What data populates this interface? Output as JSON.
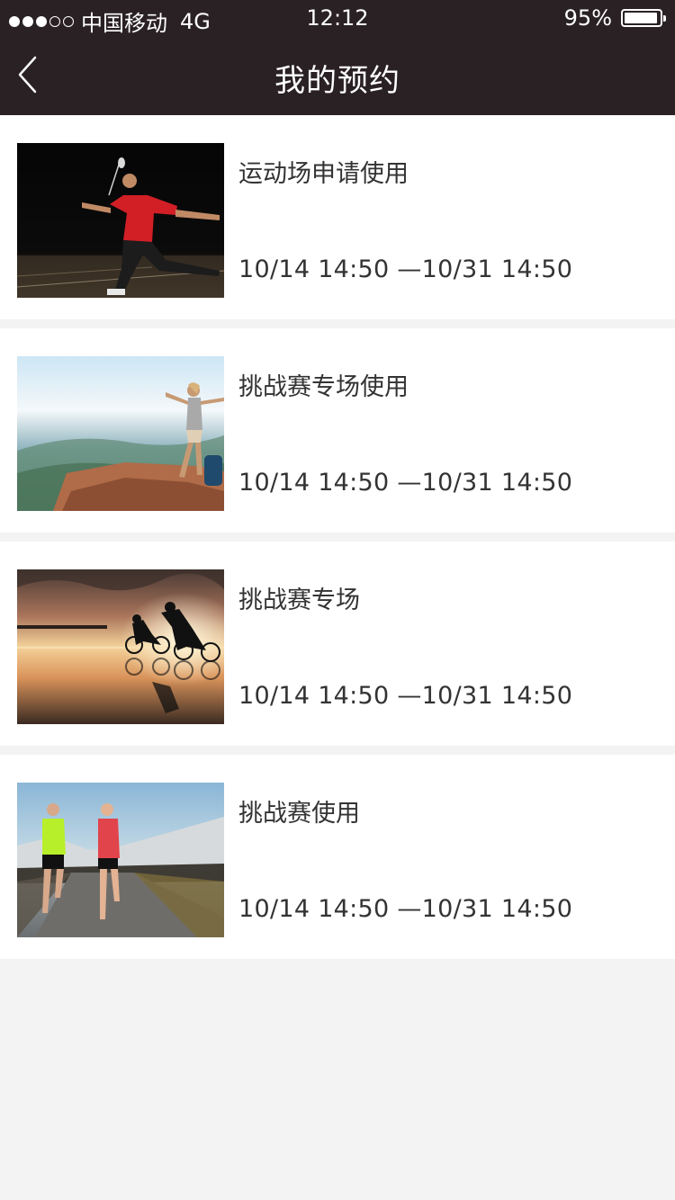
{
  "status_bar": {
    "carrier": "中国移动",
    "network": "4G",
    "time": "12:12",
    "battery": "95%",
    "battery_level": 0.95
  },
  "nav": {
    "title": "我的预约",
    "back_icon": "chevron-left-icon"
  },
  "reservations": [
    {
      "title": "运动场申请使用",
      "time": "10/14  14:50 —10/31  14:50",
      "image": "badminton-player-photo"
    },
    {
      "title": "挑战赛专场使用",
      "time": "10/14  14:50 —10/31  14:50",
      "image": "hiker-on-cliff-photo"
    },
    {
      "title": "挑战赛专场",
      "time": "10/14  14:50 —10/31  14:50",
      "image": "cyclists-sunset-photo"
    },
    {
      "title": "挑战赛使用",
      "time": "10/14  14:50 —10/31  14:50",
      "image": "runners-road-photo"
    }
  ],
  "colors": {
    "header_bg": "#2a2124",
    "page_bg": "#f3f3f3",
    "card_bg": "#ffffff",
    "text": "#333333"
  }
}
